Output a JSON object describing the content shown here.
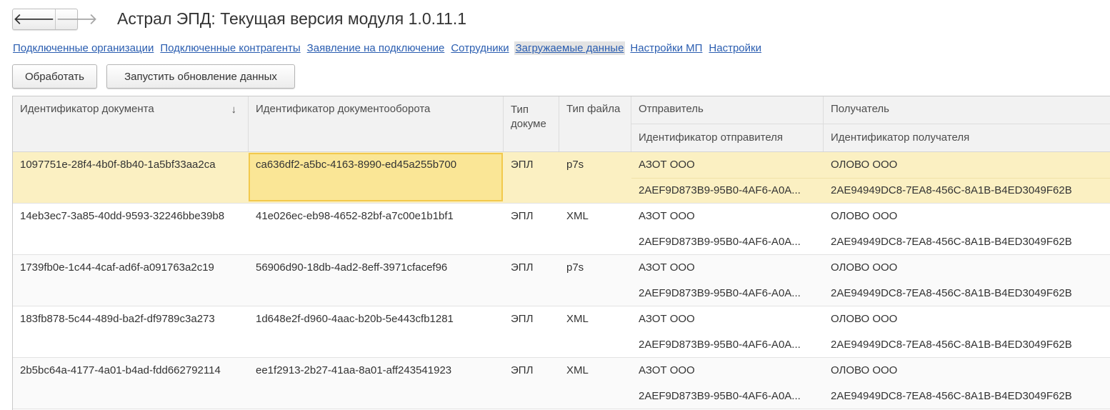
{
  "nav": {
    "back_icon": "arrow-left",
    "forward_icon": "arrow-right",
    "back_glyph": "🡐",
    "forward_glyph": "🡒"
  },
  "window": {
    "title": "Астрал ЭПД: Текущая версия модуля 1.0.11.1"
  },
  "tabs": [
    {
      "label": "Подключенные организации"
    },
    {
      "label": "Подключенные контрагенты"
    },
    {
      "label": "Заявление на подключение"
    },
    {
      "label": "Сотрудники"
    },
    {
      "label": "Загружаемые данные",
      "active": true
    },
    {
      "label": "Настройки МП"
    },
    {
      "label": "Настройки"
    }
  ],
  "toolbar": {
    "process_label": "Обработать",
    "update_label": "Запустить обновление данных"
  },
  "table": {
    "headers": {
      "doc_id": "Идентификатор документа",
      "flow_id": "Идентификатор документооборота",
      "doc_type": "Тип докуме",
      "file_type": "Тип файла",
      "sender": "Отправитель",
      "sender_id": "Идентификатор отправителя",
      "recipient": "Получатель",
      "recipient_id": "Идентификатор получателя",
      "sort_icon": "sort-descending",
      "sort_glyph": "↓"
    },
    "rows": [
      {
        "doc_id": "1097751e-28f4-4b0f-8b40-1a5bf33aa2ca",
        "flow_id": "ca636df2-a5bc-4163-8990-ed45a255b700",
        "doc_type": "ЭПЛ",
        "file_type": "p7s",
        "sender": "АЗОТ ООО",
        "sender_id": "2AEF9D873B9-95B0-4AF6-A0A...",
        "recipient": "ОЛОВО ООО",
        "recipient_id": "2AE94949DC8-7EA8-456C-8A1B-B4ED3049F62B"
      },
      {
        "doc_id": "14eb3ec7-3a85-40dd-9593-32246bbe39b8",
        "flow_id": "41e026ec-eb98-4652-82bf-a7c00e1b1bf1",
        "doc_type": "ЭПЛ",
        "file_type": "XML",
        "sender": "АЗОТ ООО",
        "sender_id": "2AEF9D873B9-95B0-4AF6-A0A...",
        "recipient": "ОЛОВО ООО",
        "recipient_id": "2AE94949DC8-7EA8-456C-8A1B-B4ED3049F62B"
      },
      {
        "doc_id": "1739fb0e-1c44-4caf-ad6f-a091763a2c19",
        "flow_id": "56906d90-18db-4ad2-8eff-3971cfacef96",
        "doc_type": "ЭПЛ",
        "file_type": "p7s",
        "sender": "АЗОТ ООО",
        "sender_id": "2AEF9D873B9-95B0-4AF6-A0A...",
        "recipient": "ОЛОВО ООО",
        "recipient_id": "2AE94949DC8-7EA8-456C-8A1B-B4ED3049F62B"
      },
      {
        "doc_id": "183fb878-5c44-489d-ba2f-df9789c3a273",
        "flow_id": "1d648e2f-d960-4aac-b20b-5e443cfb1281",
        "doc_type": "ЭПЛ",
        "file_type": "XML",
        "sender": "АЗОТ ООО",
        "sender_id": "2AEF9D873B9-95B0-4AF6-A0A...",
        "recipient": "ОЛОВО ООО",
        "recipient_id": "2AE94949DC8-7EA8-456C-8A1B-B4ED3049F62B"
      },
      {
        "doc_id": "2b5bc64a-4177-4a01-b4ad-fdd662792114",
        "flow_id": "ee1f2913-2b27-41aa-8a01-aff243541923",
        "doc_type": "ЭПЛ",
        "file_type": "XML",
        "sender": "АЗОТ ООО",
        "sender_id": "2AEF9D873B9-95B0-4AF6-A0A...",
        "recipient": "ОЛОВО ООО",
        "recipient_id": "2AE94949DC8-7EA8-456C-8A1B-B4ED3049F62B"
      }
    ]
  },
  "colors": {
    "link": "#2a5db0",
    "selected_row": "#fbf0c2",
    "focused_cell": "#fae696",
    "focus_border": "#f2c94c",
    "header_bg": "#f2f2f2"
  }
}
